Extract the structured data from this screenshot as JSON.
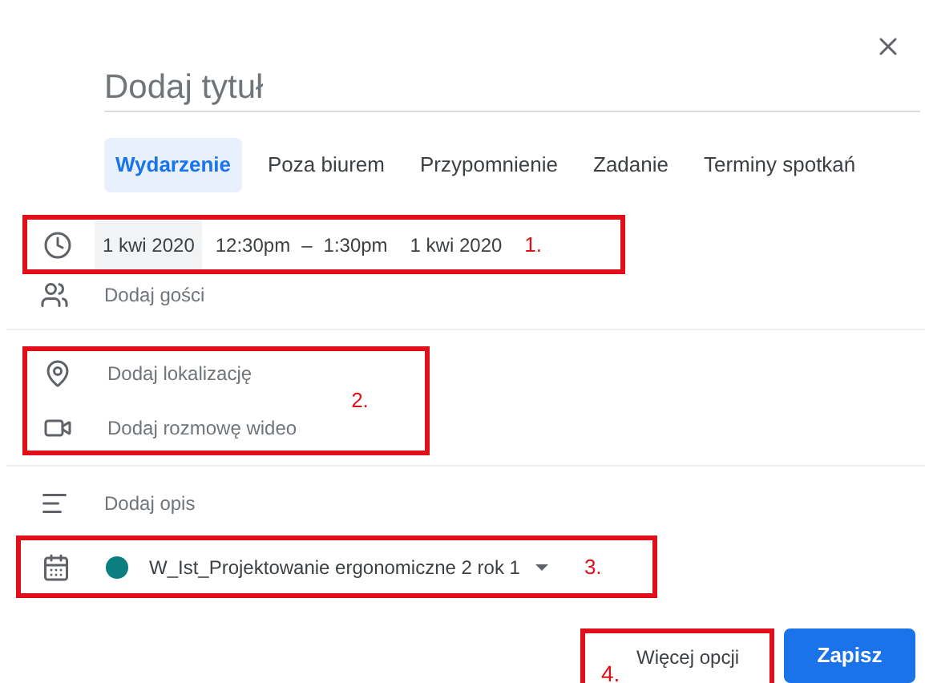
{
  "dialog": {
    "title_placeholder": "Dodaj tytuł"
  },
  "tabs": [
    {
      "label": "Wydarzenie",
      "selected": true
    },
    {
      "label": "Poza biurem",
      "selected": false
    },
    {
      "label": "Przypomnienie",
      "selected": false
    },
    {
      "label": "Zadanie",
      "selected": false
    },
    {
      "label": "Terminy spotkań",
      "selected": false
    }
  ],
  "time_row": {
    "start_date": "1 kwi 2020",
    "start_time": "12:30pm",
    "separator": "–",
    "end_time": "1:30pm",
    "end_date": "1 kwi 2020",
    "annotation": "1."
  },
  "guests": {
    "placeholder": "Dodaj gości"
  },
  "place_group": {
    "location": "Dodaj lokalizację",
    "video": "Dodaj rozmowę wideo",
    "annotation": "2."
  },
  "description": {
    "placeholder": "Dodaj opis"
  },
  "calendar": {
    "name": "W_Ist_Projektowanie ergonomiczne 2 rok 1",
    "color": "#0b7f7f",
    "annotation": "3."
  },
  "footer": {
    "more_options": "Więcej opcji",
    "annotation": "4.",
    "save": "Zapisz"
  }
}
